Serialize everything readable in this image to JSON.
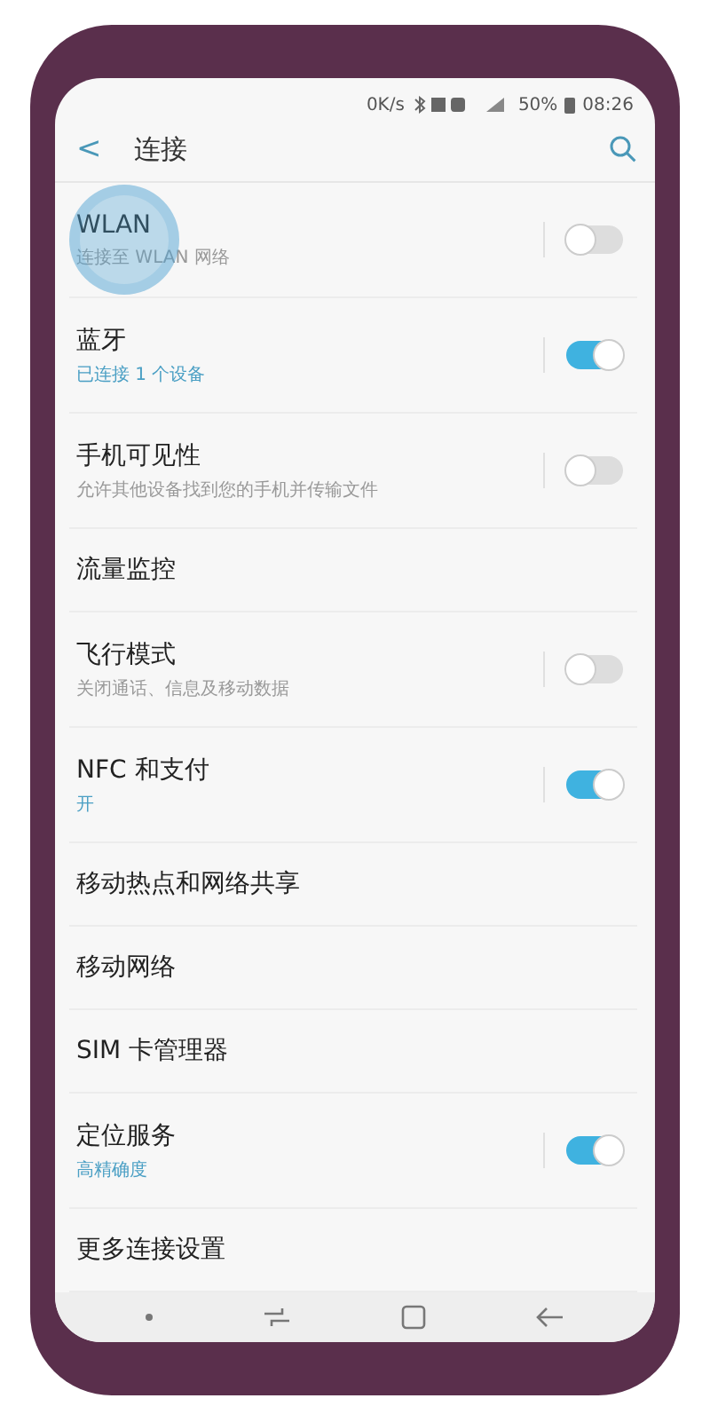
{
  "status_bar": {
    "speed": "0K/s",
    "battery": "50%",
    "time": "08:26"
  },
  "header": {
    "back": "<",
    "title": "连接"
  },
  "items": [
    {
      "kind": "toggle",
      "title": "WLAN",
      "subtitle": "连接至 WLAN 网络",
      "subtitle_accent": false,
      "on": false,
      "touched": true
    },
    {
      "kind": "toggle",
      "title": "蓝牙",
      "subtitle": "已连接 1 个设备",
      "subtitle_accent": true,
      "on": true,
      "touched": false
    },
    {
      "kind": "toggle",
      "title": "手机可见性",
      "subtitle": "允许其他设备找到您的手机并传输文件",
      "subtitle_accent": false,
      "on": false,
      "touched": false
    },
    {
      "kind": "plain",
      "title": "流量监控"
    },
    {
      "kind": "toggle",
      "title": "飞行模式",
      "subtitle": "关闭通话、信息及移动数据",
      "subtitle_accent": false,
      "on": false,
      "touched": false
    },
    {
      "kind": "toggle",
      "title": "NFC 和支付",
      "subtitle": "开",
      "subtitle_accent": true,
      "on": true,
      "touched": false
    },
    {
      "kind": "plain",
      "title": "移动热点和网络共享"
    },
    {
      "kind": "plain",
      "title": "移动网络"
    },
    {
      "kind": "plain",
      "title": "SIM 卡管理器"
    },
    {
      "kind": "toggle",
      "title": "定位服务",
      "subtitle": "高精确度",
      "subtitle_accent": true,
      "on": true,
      "touched": false
    },
    {
      "kind": "plain",
      "title": "更多连接设置"
    }
  ]
}
